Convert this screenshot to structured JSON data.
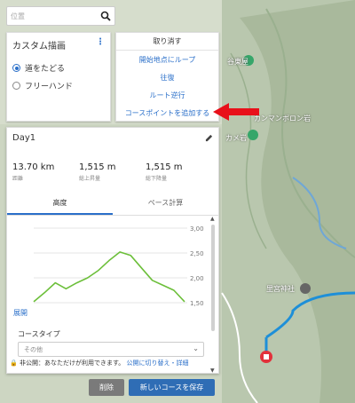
{
  "search": {
    "placeholder": "位置"
  },
  "draw_panel": {
    "title": "カスタム描画",
    "options": [
      {
        "label": "道をたどる",
        "selected": true
      },
      {
        "label": "フリーハンド",
        "selected": false
      }
    ]
  },
  "menu": {
    "items": [
      "取り消す",
      "開始地点にループ",
      "往復",
      "ルート逆行",
      "コースポイントを追加する"
    ]
  },
  "course": {
    "title": "Day1",
    "stats": [
      {
        "value": "13.70 km",
        "label": "距離"
      },
      {
        "value": "1,515 m",
        "label": "総上昇量"
      },
      {
        "value": "1,515 m",
        "label": "総下降量"
      }
    ],
    "tabs": [
      "高度",
      "ペース計算"
    ],
    "expand_label": "展開",
    "course_type_label": "コースタイプ",
    "course_type_value": "その他",
    "privacy_text": "非公開：あなただけが利用できます。",
    "privacy_link": "公開に切り替え・詳細",
    "delete_label": "削除",
    "save_label": "新しいコースを保存"
  },
  "chart_data": {
    "type": "line",
    "ylim": [
      1.5,
      3.0
    ],
    "yticks": [
      "3,00",
      "2,50",
      "2,00",
      "1,50"
    ],
    "x": [
      0,
      1,
      2,
      3,
      4,
      5,
      6,
      7,
      8,
      9,
      10,
      11,
      12,
      13,
      14
    ],
    "series": [
      {
        "values": [
          1.52,
          1.7,
          1.9,
          1.78,
          1.9,
          2.0,
          2.15,
          2.35,
          2.52,
          2.45,
          2.2,
          1.95,
          1.85,
          1.75,
          1.52
        ]
      }
    ],
    "line_color": "#6cbf3a"
  },
  "map_labels": [
    "谷東屋",
    "カンマンボロン岩",
    "カメ岩",
    "里宮神社"
  ]
}
